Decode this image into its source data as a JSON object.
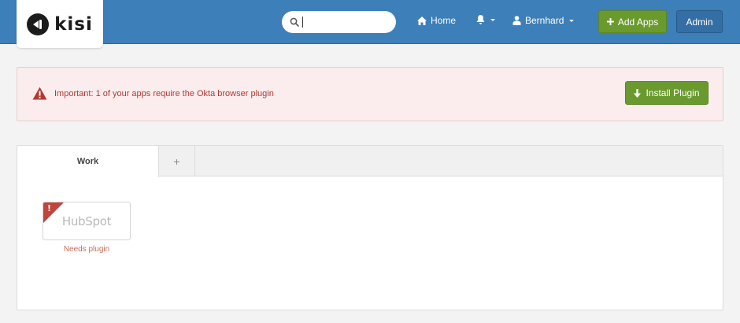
{
  "header": {
    "logo_text": "kisi",
    "search": {
      "value": "",
      "placeholder": ""
    },
    "nav": {
      "home_label": "Home",
      "user_label": "Bernhard"
    },
    "add_apps_label": "Add Apps",
    "admin_label": "Admin",
    "icons": {
      "search": "search-icon",
      "home": "home-icon",
      "bell": "bell-icon",
      "user": "user-icon",
      "plus": "plus-icon"
    }
  },
  "alert": {
    "message": "Important: 1 of your apps require the Okta browser plugin",
    "button_label": "Install Plugin",
    "icons": {
      "warning": "warning-icon",
      "download": "download-arrow-icon"
    }
  },
  "tabs": [
    {
      "label": "Work",
      "active": true
    },
    {
      "label": "+",
      "active": false
    }
  ],
  "apps": [
    {
      "name": "HubSpot",
      "logo_text": "HubSpot",
      "status": "Needs plugin",
      "badge": "!"
    }
  ],
  "colors": {
    "header_bg": "#3d7fb8",
    "primary_green": "#6a9a2e",
    "admin_blue": "#336ea5",
    "alert_bg": "#fbeced",
    "alert_text": "#b03a33",
    "badge_red": "#c0463d"
  }
}
